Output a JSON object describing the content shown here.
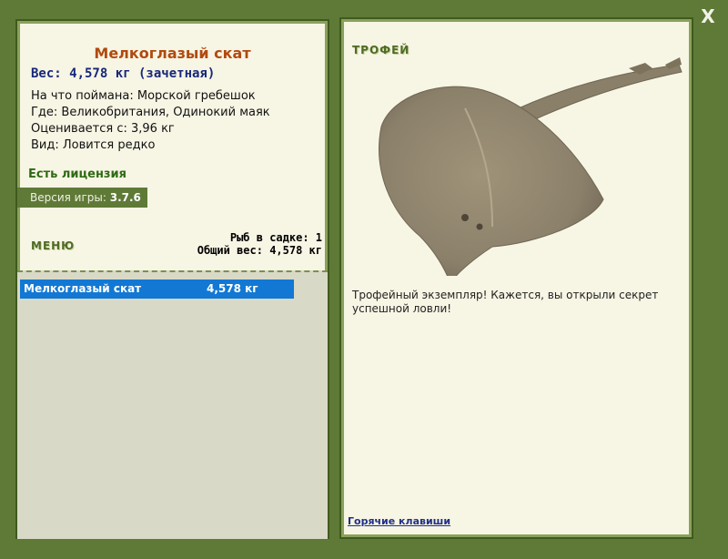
{
  "window": {
    "close_label": "X"
  },
  "left": {
    "fish_name": "Мелкоглазый скат",
    "weight_line": "Вес: 4,578 кг (зачетная)",
    "details": [
      "На что поймана: Морской гребешок",
      "Где: Великобритания, Одинокий маяк",
      "Оценивается с: 3,96 кг",
      "Вид: Ловится редко"
    ],
    "license": "Есть лицензия",
    "version_label": "Версия игры: ",
    "version_value": "3.7.6",
    "menu_label": "МЕНЮ",
    "keep_count_line": "Рыб в садке: 1",
    "keep_weight_line": "Общий вес: 4,578 кг",
    "list": [
      {
        "name": "Мелкоглазый скат",
        "weight": "4,578 кг"
      }
    ]
  },
  "right": {
    "trophy_label": "ТРОФЕЙ",
    "description": "Трофейный экземпляр! Кажется, вы открыли секрет успешной ловли!",
    "hotkeys_link": "Горячие клавиши"
  },
  "colors": {
    "background": "#5f7a37",
    "panel": "#f7f5e4",
    "title": "#b14a10",
    "weight": "#18277a",
    "license": "#2f6a14",
    "selected_row": "#1278d4"
  }
}
